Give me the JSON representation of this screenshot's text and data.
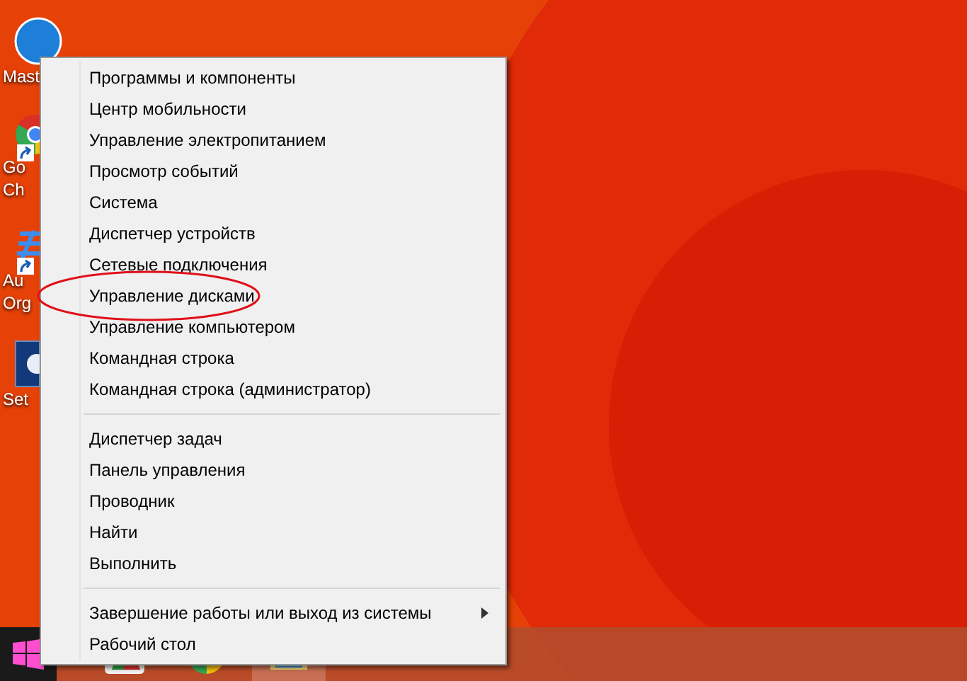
{
  "desktop_icons": [
    {
      "kind": "circle",
      "shortcut": false,
      "label_lines": [
        "Mast"
      ]
    },
    {
      "kind": "browser",
      "shortcut": true,
      "label_lines": [
        "Go",
        "Ch"
      ]
    },
    {
      "kind": "lines",
      "shortcut": true,
      "label_lines": [
        "Au",
        "Org"
      ]
    },
    {
      "kind": "setup",
      "shortcut": false,
      "label_lines": [
        "Set"
      ]
    }
  ],
  "context_menu": {
    "groups": [
      {
        "items": [
          {
            "label": "Программы и компоненты",
            "submenu": false,
            "circled": false
          },
          {
            "label": "Центр мобильности",
            "submenu": false,
            "circled": false
          },
          {
            "label": "Управление электропитанием",
            "submenu": false,
            "circled": false
          },
          {
            "label": "Просмотр событий",
            "submenu": false,
            "circled": false
          },
          {
            "label": "Система",
            "submenu": false,
            "circled": false
          },
          {
            "label": "Диспетчер устройств",
            "submenu": false,
            "circled": false
          },
          {
            "label": "Сетевые подключения",
            "submenu": false,
            "circled": false
          },
          {
            "label": "Управление дисками",
            "submenu": false,
            "circled": true
          },
          {
            "label": "Управление компьютером",
            "submenu": false,
            "circled": false
          },
          {
            "label": "Командная строка",
            "submenu": false,
            "circled": false
          },
          {
            "label": "Командная строка (администратор)",
            "submenu": false,
            "circled": false
          }
        ]
      },
      {
        "items": [
          {
            "label": "Диспетчер задач",
            "submenu": false,
            "circled": false
          },
          {
            "label": "Панель управления",
            "submenu": false,
            "circled": false
          },
          {
            "label": "Проводник",
            "submenu": false,
            "circled": false
          },
          {
            "label": "Найти",
            "submenu": false,
            "circled": false
          },
          {
            "label": "Выполнить",
            "submenu": false,
            "circled": false
          }
        ]
      },
      {
        "items": [
          {
            "label": "Завершение работы или выход из системы",
            "submenu": true,
            "circled": false
          },
          {
            "label": "Рабочий стол",
            "submenu": false,
            "circled": false
          }
        ]
      }
    ]
  },
  "taskbar": {
    "items": [
      {
        "kind": "flag",
        "selected": false
      },
      {
        "kind": "browser",
        "selected": false
      },
      {
        "kind": "folder",
        "selected": true
      }
    ]
  }
}
